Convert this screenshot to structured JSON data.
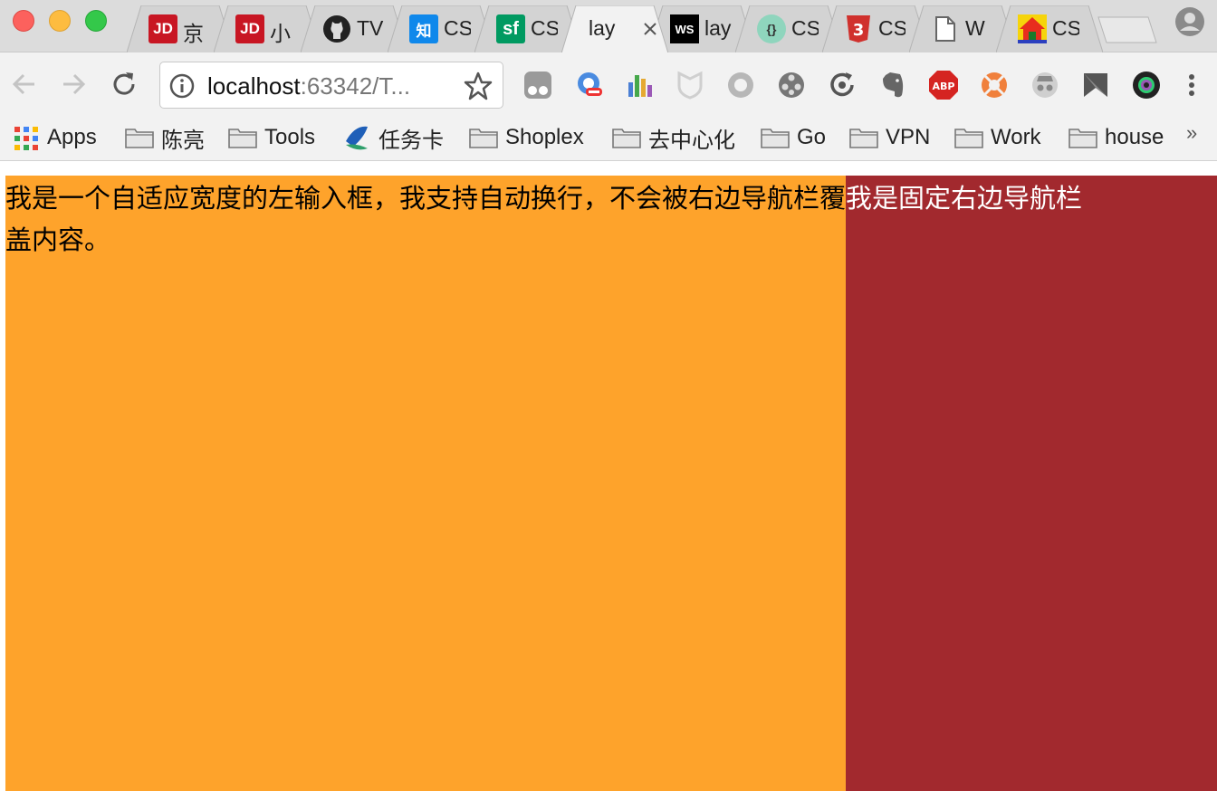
{
  "window": {
    "buttons": [
      "close",
      "minimize",
      "maximize"
    ]
  },
  "tabs": [
    {
      "favicon": "jd-icon",
      "favicon_text": "JD",
      "favicon_color": "#c81623",
      "title": "京"
    },
    {
      "favicon": "jd-icon",
      "favicon_text": "JD",
      "favicon_color": "#c81623",
      "title": "小"
    },
    {
      "favicon": "github-icon",
      "favicon_text": "",
      "favicon_color": "#222222",
      "title": "TV"
    },
    {
      "favicon": "zhihu-icon",
      "favicon_text": "知",
      "favicon_color": "#0f88eb",
      "title": "CS"
    },
    {
      "favicon": "segmentfault-icon",
      "favicon_text": "sf",
      "favicon_color": "#009a61",
      "title": "CS"
    },
    {
      "favicon": "none",
      "favicon_text": "",
      "favicon_color": "",
      "title": "lay",
      "active": true
    },
    {
      "favicon": "webstorm-icon",
      "favicon_text": "WS",
      "favicon_color": "#000000",
      "title": "lay"
    },
    {
      "favicon": "codepen-pencil-icon",
      "favicon_text": "{}",
      "favicon_color": "#6ec6a8",
      "title": "CS"
    },
    {
      "favicon": "css3-icon",
      "favicon_text": "3",
      "favicon_color": "#d0312d",
      "title": "CS"
    },
    {
      "favicon": "document-icon",
      "favicon_text": "",
      "favicon_color": "#666666",
      "title": "W"
    },
    {
      "favicon": "house-colorful-icon",
      "favicon_text": "",
      "favicon_color": "#e82d1e",
      "title": "CS"
    }
  ],
  "toolbar": {
    "url_host": "localhost",
    "url_rest": ":63342/T...",
    "extensions": [
      "tampermonkey-icon",
      "proxy-switch-icon",
      "chart-bars-icon",
      "shield-extension-icon",
      "circle-extension-icon",
      "film-reel-icon",
      "refresh-extension-icon",
      "evernote-icon",
      "adblock-plus-icon",
      "lifebuoy-icon",
      "spy-hat-icon",
      "pushbullet-icon",
      "camera-lens-icon",
      "more-vert-icon"
    ],
    "adblock_text": "ABP"
  },
  "bookmarks": {
    "apps": "Apps",
    "items": [
      "陈亮",
      "Tools",
      "任务卡",
      "Shoplex",
      "去中心化",
      "Go",
      "VPN",
      "Work",
      "house"
    ],
    "overflow": "»"
  },
  "page": {
    "left_text": "我是一个自适应宽度的左输入框，我支持自动换行，不会被右边导航栏覆盖内容。",
    "right_text": "我是固定右边导航栏",
    "left_color": "#fea32b",
    "right_color": "#a2292e"
  }
}
